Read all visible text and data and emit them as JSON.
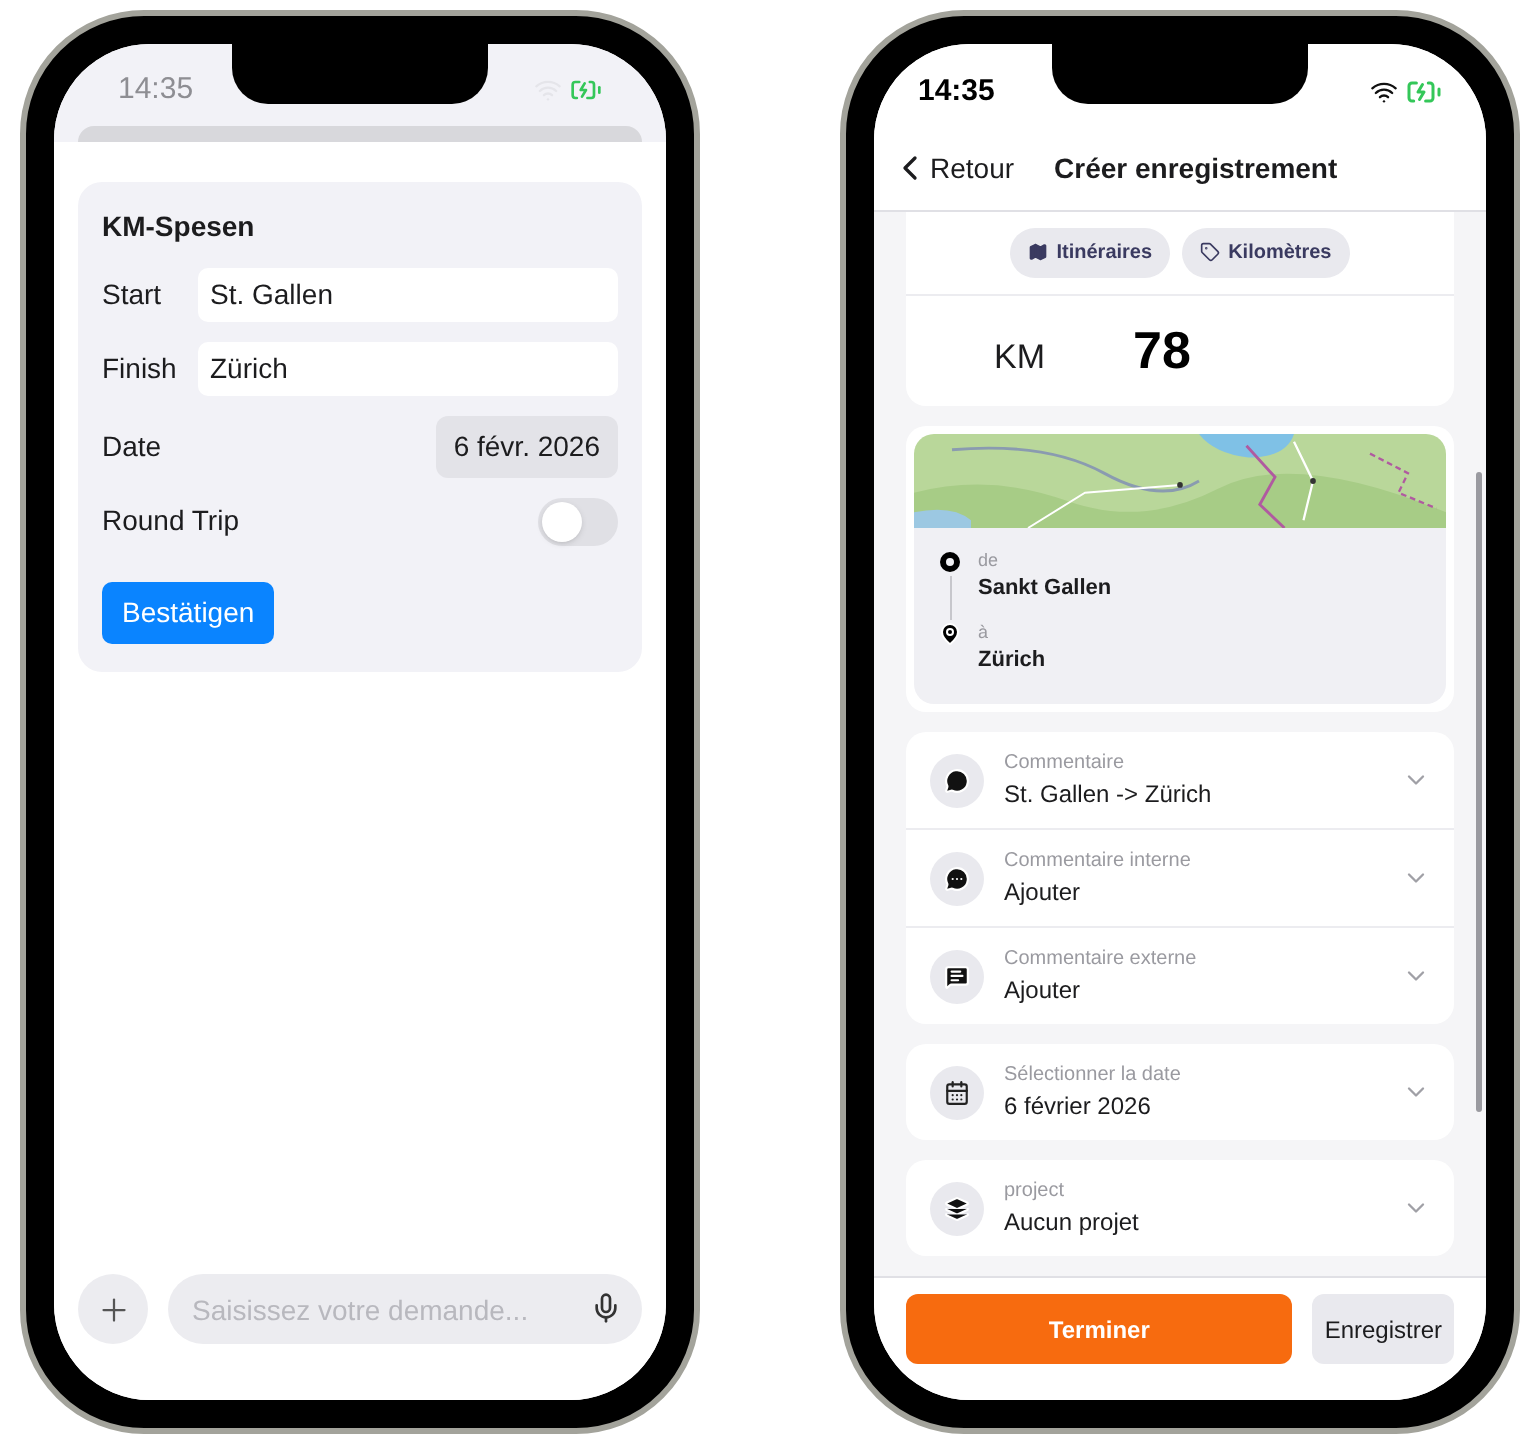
{
  "chat_screen": {
    "status_bar": {
      "time": "14:35"
    },
    "form": {
      "title": "KM-Spesen",
      "fields": [
        {
          "label": "Start",
          "value": "St. Gallen"
        },
        {
          "label": "Finish",
          "value": "Zürich"
        }
      ],
      "date": {
        "label": "Date",
        "value": "6 févr. 2026"
      },
      "round_trip": {
        "label": "Round Trip",
        "on": false
      },
      "confirm_button": "Bestätigen"
    },
    "composer": {
      "placeholder": "Saisissez votre demande..."
    }
  },
  "record_screen": {
    "status_bar": {
      "time": "14:35"
    },
    "nav": {
      "back": "Retour",
      "title": "Créer enregistrement"
    },
    "mode_chips": [
      {
        "kind": "route",
        "label": "Itinéraires"
      },
      {
        "kind": "tag",
        "label": "Kilomètres"
      }
    ],
    "distance": {
      "unit": "KM",
      "value": "78"
    },
    "route": [
      {
        "kind": "origin",
        "caption": "de",
        "place": "Sankt Gallen"
      },
      {
        "kind": "destination",
        "caption": "à",
        "place": "Zürich"
      }
    ],
    "groups": [
      {
        "rows": [
          {
            "kind": "comment",
            "label": "Commentaire",
            "value": "St. Gallen -> Zürich"
          },
          {
            "kind": "comment-dots",
            "label": "Commentaire interne",
            "value": "Ajouter"
          },
          {
            "kind": "comment-lines",
            "label": "Commentaire externe",
            "value": "Ajouter"
          }
        ]
      },
      {
        "rows": [
          {
            "kind": "calendar",
            "label": "Sélectionner la date",
            "value": "6 février 2026"
          }
        ]
      },
      {
        "rows": [
          {
            "kind": "layers",
            "label": "project",
            "value": "Aucun projet"
          }
        ]
      }
    ],
    "actions": [
      {
        "kind": "primary",
        "label": "Terminer"
      },
      {
        "kind": "secondary",
        "label": "Enregistrer"
      }
    ]
  }
}
